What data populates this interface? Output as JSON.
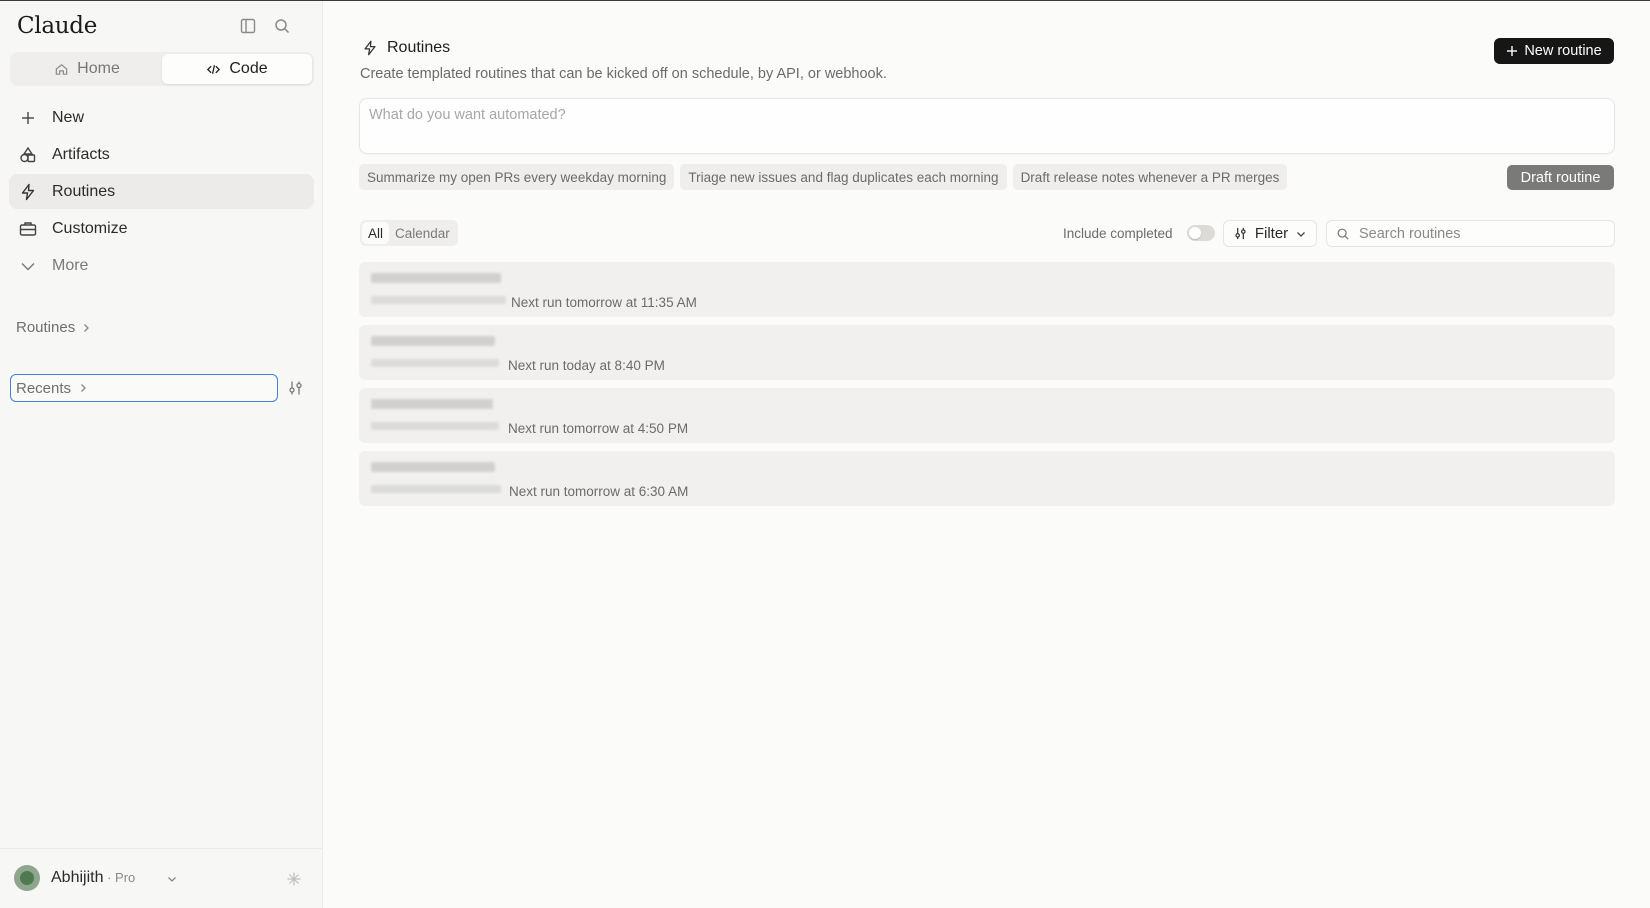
{
  "app": {
    "brand": "Claude"
  },
  "sidebar": {
    "toggle": {
      "home": "Home",
      "code": "Code",
      "active": "code"
    },
    "nav": [
      {
        "label": "New",
        "icon": "plus-icon"
      },
      {
        "label": "Artifacts",
        "icon": "shapes-icon"
      },
      {
        "label": "Routines",
        "icon": "bolt-icon",
        "active": true
      },
      {
        "label": "Customize",
        "icon": "briefcase-icon"
      },
      {
        "label": "More",
        "icon": "chevron-down-icon"
      }
    ],
    "routines_link": "Routines",
    "recents_label": "Recents",
    "user": {
      "name": "Abhijith",
      "plan": "Pro"
    }
  },
  "main": {
    "title": "Routines",
    "subtitle": "Create templated routines that can be kicked off on schedule, by API, or webhook.",
    "new_routine_label": "New routine",
    "prompt_placeholder": "What do you want automated?",
    "suggestions": [
      "Summarize my open PRs every weekday morning",
      "Triage new issues and flag duplicates each morning",
      "Draft release notes whenever a PR merges"
    ],
    "draft_label": "Draft routine",
    "tabs": [
      "All",
      "Calendar"
    ],
    "active_tab": "All",
    "include_completed_label": "Include completed",
    "include_completed": false,
    "filter_label": "Filter",
    "search_placeholder": "Search routines",
    "routines": [
      {
        "next_run": "Next run tomorrow at 11:35 AM"
      },
      {
        "next_run": "Next run today at 8:40 PM"
      },
      {
        "next_run": "Next run tomorrow at 4:50 PM"
      },
      {
        "next_run": "Next run tomorrow at 6:30 AM"
      }
    ]
  },
  "colors": {
    "primary_button": "#161616",
    "focus_ring": "#4a7fd1",
    "draft_button": "#7a7a78"
  }
}
